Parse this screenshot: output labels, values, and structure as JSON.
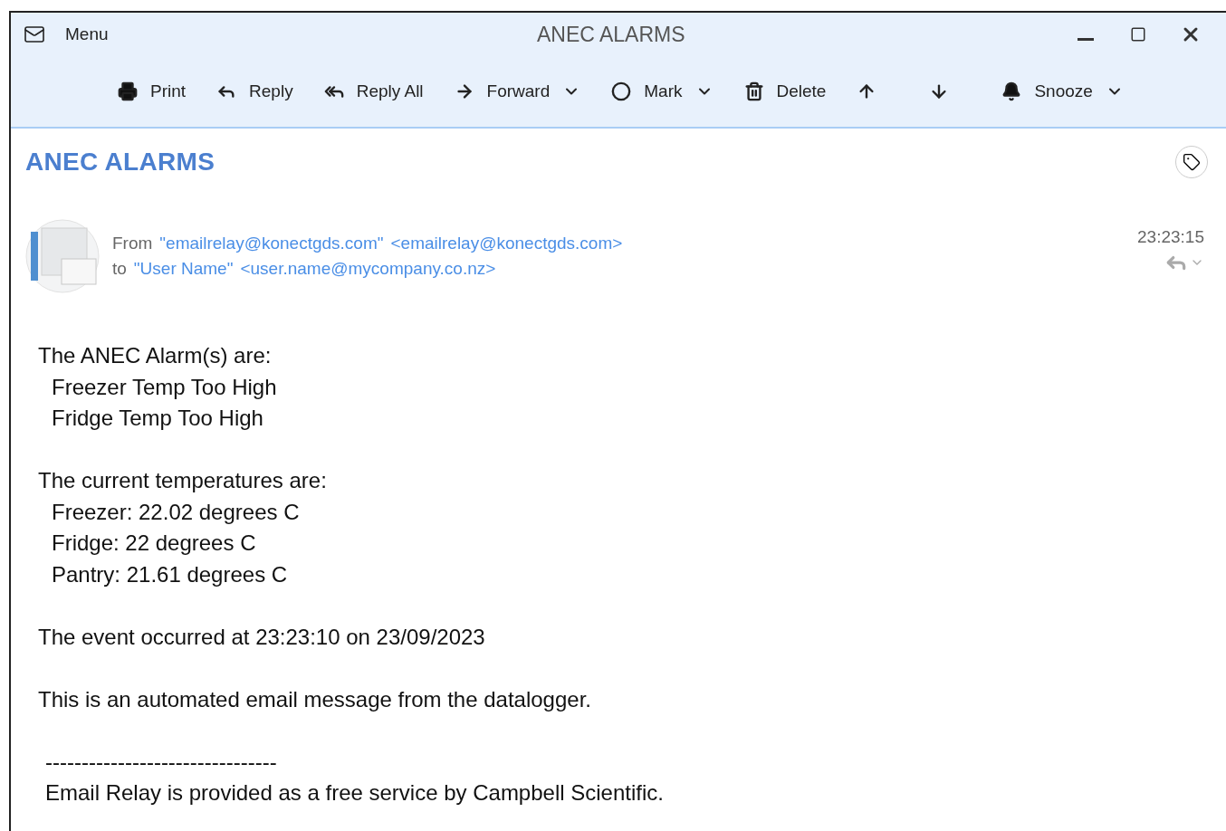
{
  "window": {
    "title": "ANEC ALARMS",
    "menu": "Menu"
  },
  "toolbar": [
    {
      "kind": "print",
      "label": "Print",
      "dropdown": false
    },
    {
      "kind": "reply",
      "label": "Reply",
      "dropdown": false
    },
    {
      "kind": "reply-all",
      "label": "Reply All",
      "dropdown": false
    },
    {
      "kind": "forward",
      "label": "Forward",
      "dropdown": true
    },
    {
      "kind": "mark",
      "label": "Mark",
      "dropdown": true
    },
    {
      "kind": "delete",
      "label": "Delete",
      "dropdown": false
    },
    {
      "kind": "up",
      "dropdown": false
    },
    {
      "kind": "down",
      "dropdown": false
    },
    {
      "kind": "snooze",
      "label": "Snooze",
      "dropdown": true
    }
  ],
  "message": {
    "subject": "ANEC ALARMS",
    "from_label": "From",
    "from_name": "\"emailrelay@konectgds.com\"",
    "from_address": "<emailrelay@konectgds.com>",
    "to_label": "to",
    "to_name": "\"User Name\"",
    "to_address": "<user.name@mycompany.co.nz>",
    "time": "23:23:15"
  },
  "body": [
    [
      {
        "kind": "text",
        "text": "The ANEC Alarm(s) are:"
      },
      {
        "kind": "item",
        "text": "Freezer Temp Too High"
      },
      {
        "kind": "item",
        "text": "Fridge Temp Too High"
      }
    ],
    [
      {
        "kind": "text",
        "text": "The current temperatures are:"
      },
      {
        "kind": "item",
        "text": "Freezer: 22.02 degrees C"
      },
      {
        "kind": "item",
        "text": "Fridge: 22 degrees C"
      },
      {
        "kind": "item",
        "text": "Pantry: 21.61 degrees C"
      }
    ],
    [
      {
        "kind": "text",
        "text": "The event occurred at 23:23:10 on 23/09/2023"
      }
    ],
    [
      {
        "kind": "text",
        "text": "This is an automated email message from the datalogger."
      }
    ],
    [
      {
        "kind": "footer",
        "text": "--------------------------------"
      },
      {
        "kind": "footer",
        "text": "Email Relay is provided as a free service by Campbell Scientific."
      }
    ]
  ]
}
